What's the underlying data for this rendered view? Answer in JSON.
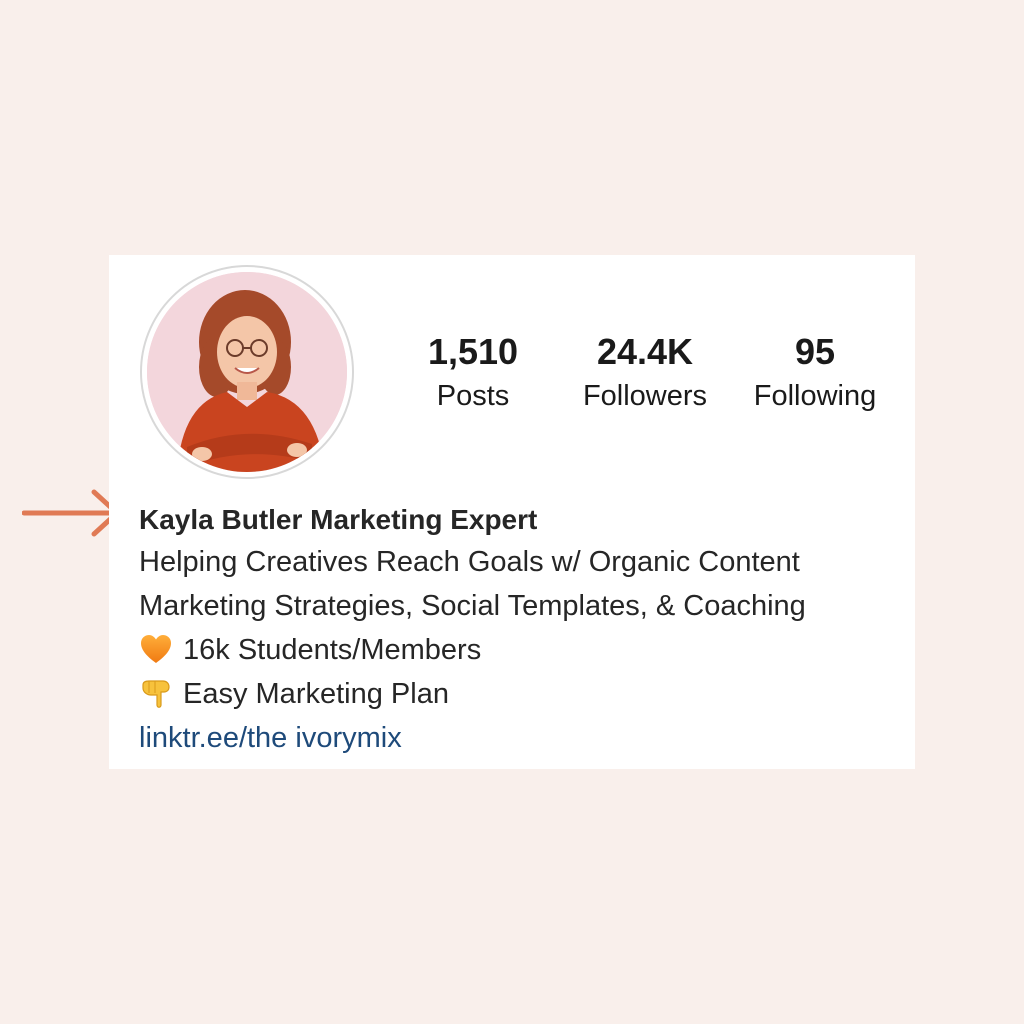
{
  "profile": {
    "stats": {
      "posts": {
        "value": "1,510",
        "label": "Posts"
      },
      "followers": {
        "value": "24.4K",
        "label": "Followers"
      },
      "following": {
        "value": "95",
        "label": "Following"
      }
    },
    "bio": {
      "name": "Kayla Butler Marketing Expert",
      "line1": "Helping Creatives Reach Goals w/ Organic Content",
      "line2": "Marketing Strategies, Social Templates, & Coaching",
      "line3": "16k Students/Members",
      "line4": "Easy Marketing Plan",
      "link": "linktr.ee/the ivorymix"
    },
    "icons": {
      "line3": "orange-heart-icon",
      "line4": "pointing-down-hand-icon"
    }
  },
  "colors": {
    "background": "#f9efeb",
    "arrow": "#e07a55",
    "link": "#1e4a7a"
  }
}
